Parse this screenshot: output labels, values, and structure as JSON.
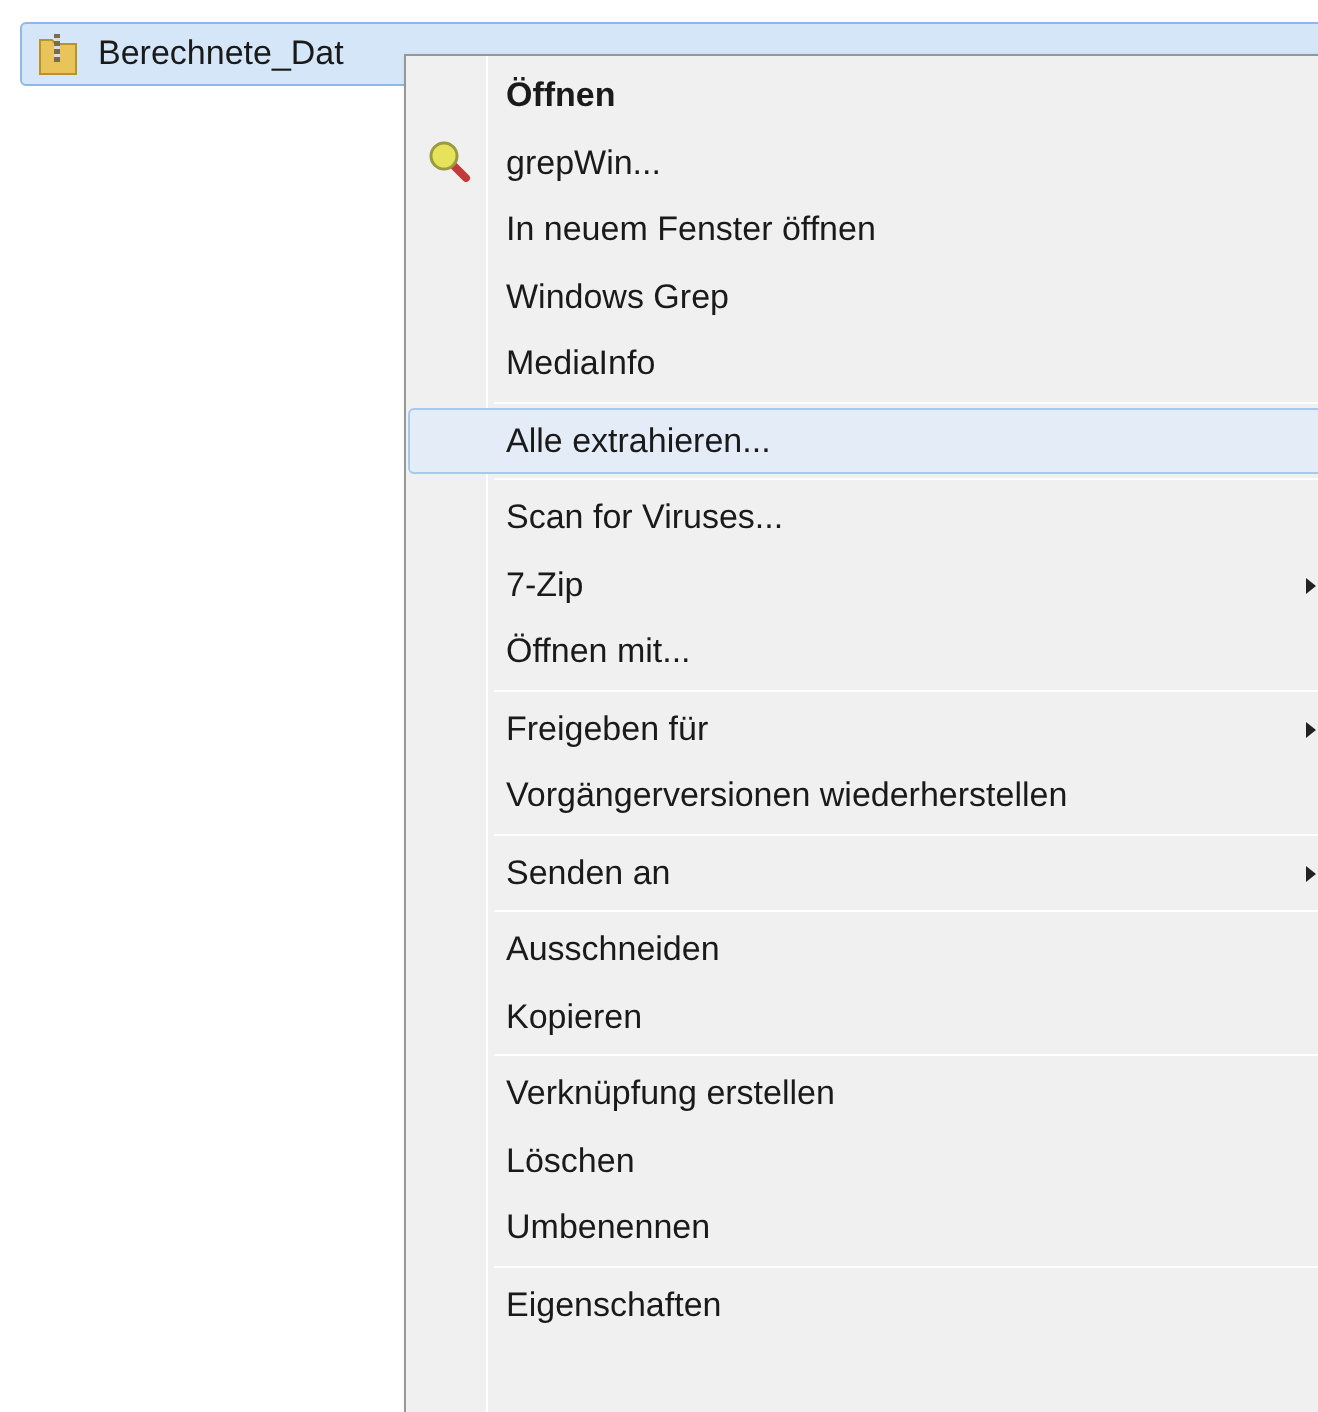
{
  "file_row": {
    "name": "Berechnete_Dat",
    "selected": true
  },
  "context_menu": {
    "groups": [
      [
        {
          "label": "Öffnen",
          "default": true,
          "has_icon": false,
          "has_submenu": false,
          "selected": false
        },
        {
          "label": "grepWin...",
          "default": false,
          "has_icon": true,
          "has_submenu": false,
          "selected": false
        },
        {
          "label": "In neuem Fenster öffnen",
          "default": false,
          "has_icon": false,
          "has_submenu": false,
          "selected": false
        },
        {
          "label": "Windows Grep",
          "default": false,
          "has_icon": false,
          "has_submenu": false,
          "selected": false
        },
        {
          "label": "MediaInfo",
          "default": false,
          "has_icon": false,
          "has_submenu": false,
          "selected": false
        }
      ],
      [
        {
          "label": "Alle extrahieren...",
          "default": false,
          "has_icon": false,
          "has_submenu": false,
          "selected": true
        }
      ],
      [
        {
          "label": "Scan for Viruses...",
          "default": false,
          "has_icon": false,
          "has_submenu": false,
          "selected": false
        },
        {
          "label": "7-Zip",
          "default": false,
          "has_icon": false,
          "has_submenu": true,
          "selected": false
        },
        {
          "label": "Öffnen mit...",
          "default": false,
          "has_icon": false,
          "has_submenu": false,
          "selected": false
        }
      ],
      [
        {
          "label": "Freigeben für",
          "default": false,
          "has_icon": false,
          "has_submenu": true,
          "selected": false
        },
        {
          "label": "Vorgängerversionen wiederherstellen",
          "default": false,
          "has_icon": false,
          "has_submenu": false,
          "selected": false
        }
      ],
      [
        {
          "label": "Senden an",
          "default": false,
          "has_icon": false,
          "has_submenu": true,
          "selected": false
        }
      ],
      [
        {
          "label": "Ausschneiden",
          "default": false,
          "has_icon": false,
          "has_submenu": false,
          "selected": false
        },
        {
          "label": "Kopieren",
          "default": false,
          "has_icon": false,
          "has_submenu": false,
          "selected": false
        }
      ],
      [
        {
          "label": "Verknüpfung erstellen",
          "default": false,
          "has_icon": false,
          "has_submenu": false,
          "selected": false
        },
        {
          "label": "Löschen",
          "default": false,
          "has_icon": false,
          "has_submenu": false,
          "selected": false
        },
        {
          "label": "Umbenennen",
          "default": false,
          "has_icon": false,
          "has_submenu": false,
          "selected": false
        }
      ],
      [
        {
          "label": "Eigenschaften",
          "default": false,
          "has_icon": false,
          "has_submenu": false,
          "selected": false
        }
      ]
    ]
  }
}
